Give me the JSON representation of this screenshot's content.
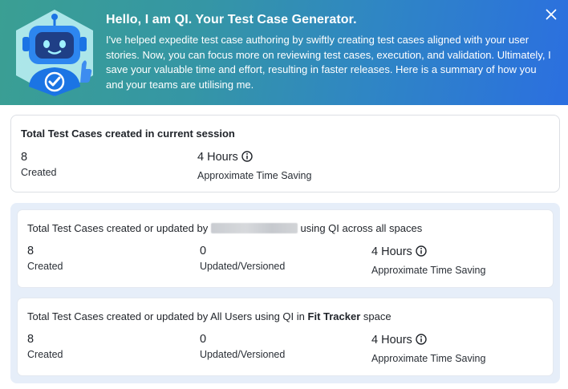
{
  "banner": {
    "title": "Hello, I am QI. Your Test Case Generator.",
    "description": "I've helped expedite test case authoring by swiftly creating test cases aligned with your user stories. Now, you can focus more on reviewing test cases, execution, and validation. Ultimately, I save your valuable time and effort, resulting in faster releases. Here is a summary of how you and your teams are utilising me.",
    "close_icon": "close-icon",
    "avatar_icon": "robot-check-icon"
  },
  "session": {
    "heading": "Total Test Cases created in current session",
    "created_value": "8",
    "created_label": "Created",
    "saving_value": "4 Hours",
    "saving_label": "Approximate Time Saving"
  },
  "user_spaces": {
    "heading_prefix": "Total Test Cases created or updated by",
    "heading_suffix": "using QI across all spaces",
    "created_value": "8",
    "created_label": "Created",
    "updated_value": "0",
    "updated_label": "Updated/Versioned",
    "saving_value": "4 Hours",
    "saving_label": "Approximate Time Saving"
  },
  "space": {
    "heading_prefix": "Total Test Cases created or updated by All Users using QI in",
    "space_name": "Fit Tracker",
    "heading_suffix": "space",
    "created_value": "8",
    "created_label": "Created",
    "updated_value": "0",
    "updated_label": "Updated/Versioned",
    "saving_value": "4 Hours",
    "saving_label": "Approximate Time Saving"
  },
  "colors": {
    "banner_start": "#3a9f93",
    "banner_end": "#2b6fe0",
    "group_bg": "#e6eef9"
  }
}
